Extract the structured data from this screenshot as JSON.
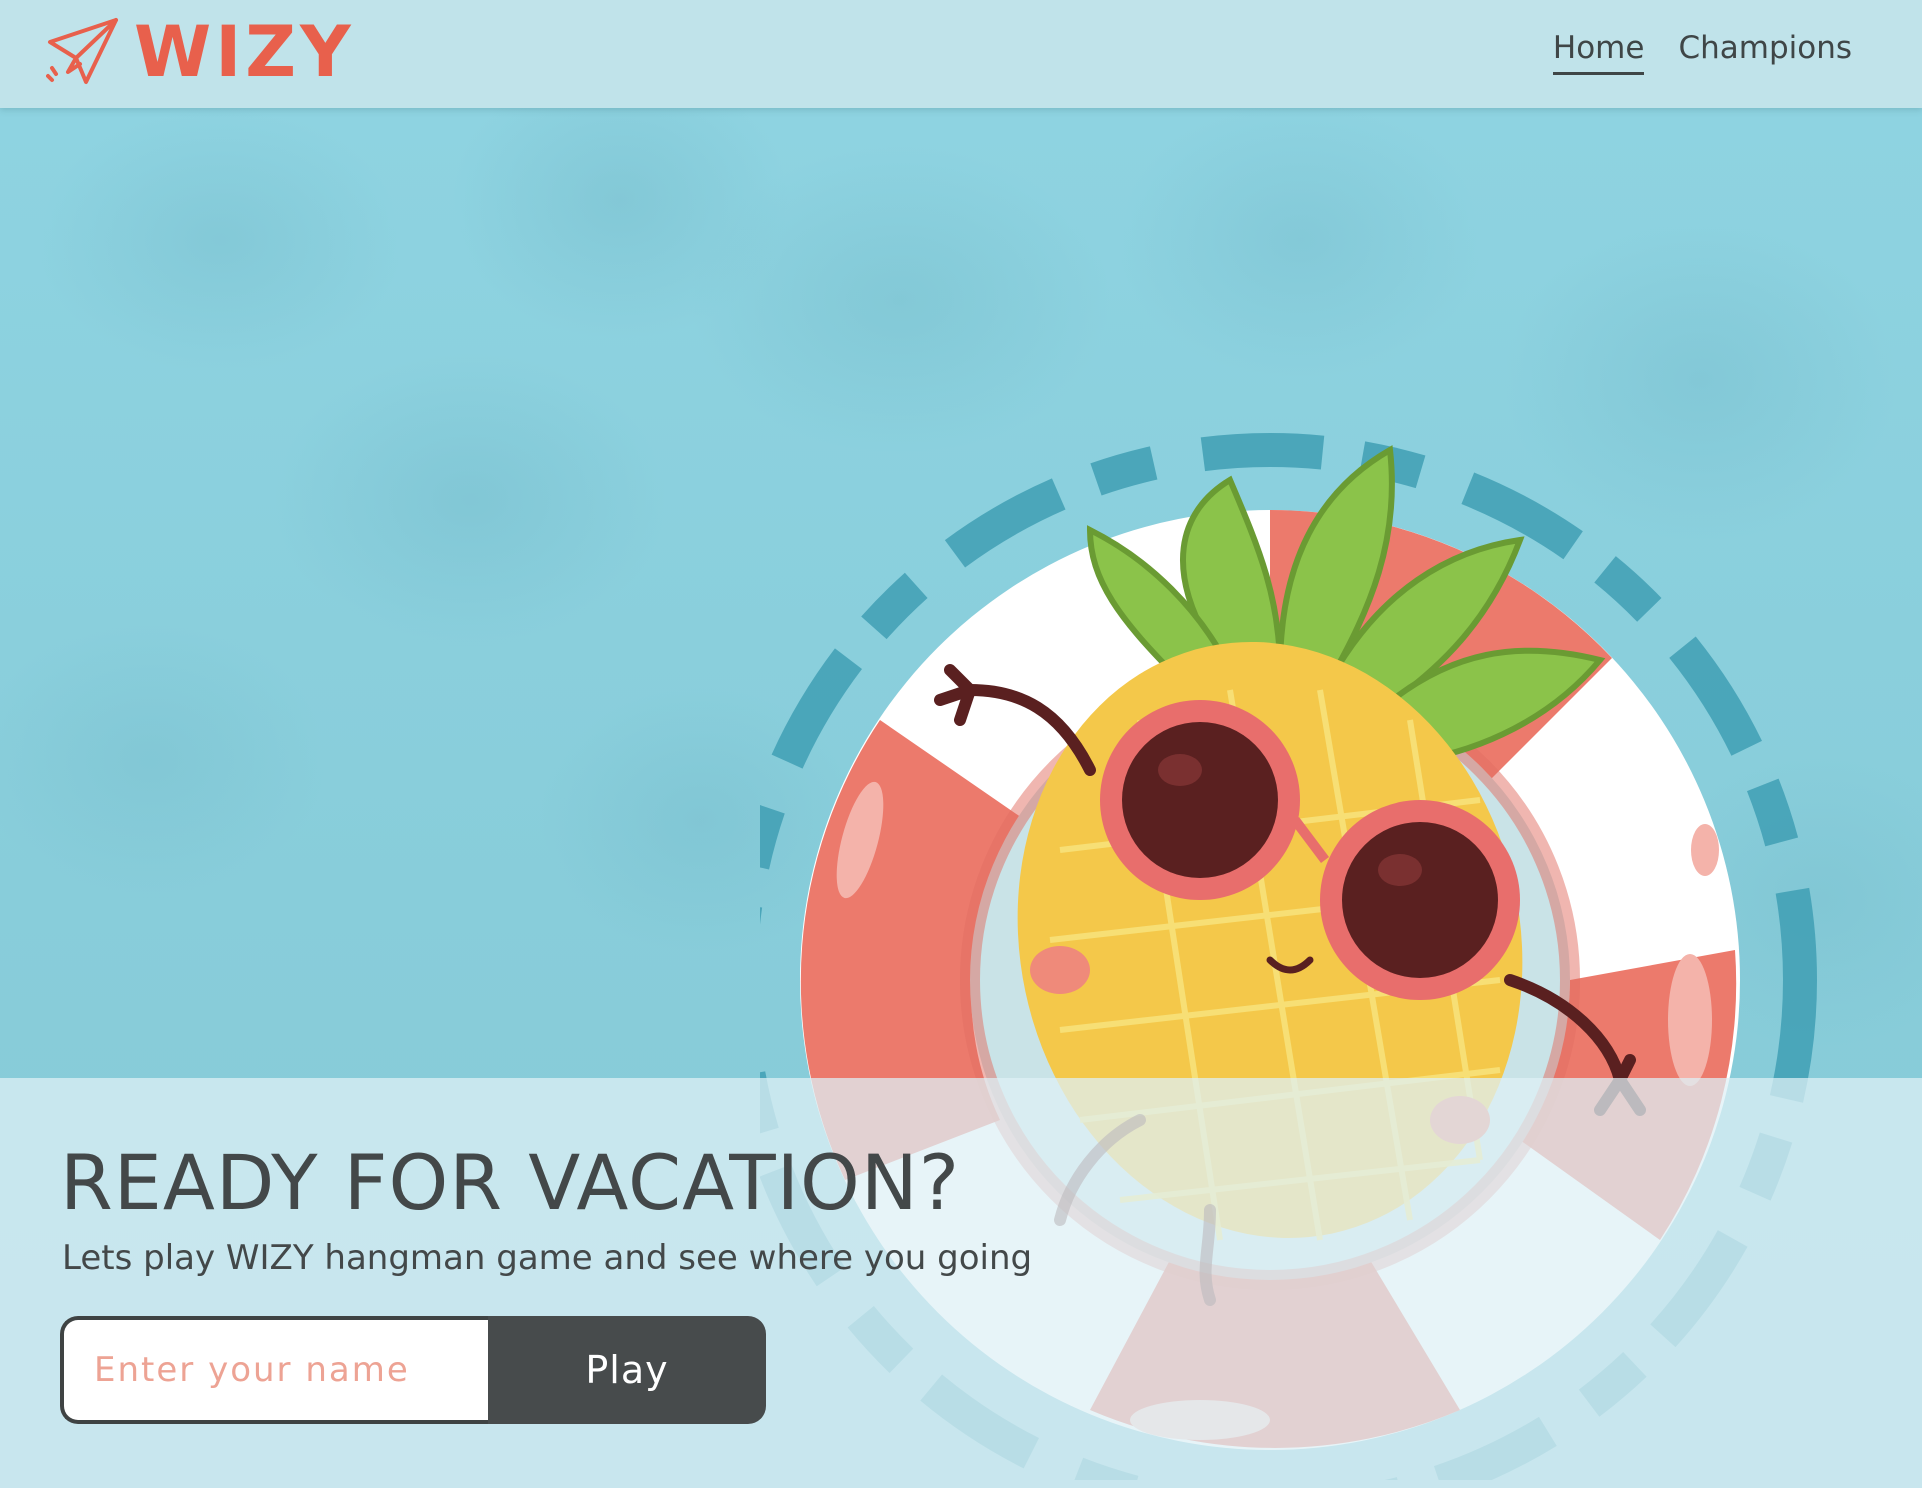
{
  "header": {
    "logo_text": "WIZY",
    "logo_icon": "paper-plane-icon",
    "nav": {
      "home_label": "Home",
      "champions_label": "Champions",
      "active": "Home"
    }
  },
  "hero": {
    "title": "READY FOR VACATION?",
    "subtitle": "Lets play WIZY hangman game and see where you going",
    "name_input": {
      "value": "",
      "placeholder": "Enter your name"
    },
    "play_label": "Play"
  },
  "colors": {
    "brand": "#e8604c",
    "text_dark": "#434849",
    "button_bg": "#474b4c",
    "water": "#8ccfdb",
    "placeholder": "#eda394"
  }
}
